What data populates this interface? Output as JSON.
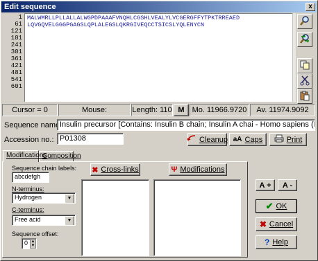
{
  "window": {
    "title": "Edit sequence",
    "close_glyph": "x"
  },
  "sequence": {
    "line_numbers": [
      "1",
      "61",
      "121",
      "181",
      "241",
      "301",
      "361",
      "421",
      "481",
      "541",
      "601"
    ],
    "lines": [
      "MALWMRLLPLLALLALWGPDPAAAFVNQHLCGSHLVEALYLVCGERGFFYTPKTRREAED",
      "LQVGQVELGGGPGAGSLQPLALEGSLQKRGIVEQCCTSICSLYQLENYCN"
    ]
  },
  "toolbar": {
    "icons": [
      "search-icon",
      "find-replace-icon",
      "copy-icon",
      "cut-icon",
      "paste-icon"
    ]
  },
  "status": {
    "cursor": "Cursor = 0",
    "mouse": "Mouse:",
    "length": "Length: 110",
    "m_button": "M",
    "mono": "Mo. 11966.9720",
    "avg": "Av. 11974.9092"
  },
  "fields": {
    "sequence_name_label": "Sequence name:",
    "sequence_name_value": "Insulin precursor [Contains: Insulin B chain; Insulin A chai - Homo sapiens (Human).",
    "accession_label": "Accession no.:",
    "accession_value": "P01308"
  },
  "buttons": {
    "cleanup": "Cleanup",
    "caps": "Caps",
    "caps_prefix": "aA",
    "print": "Print",
    "cross_links": "Cross-links",
    "modifications": "Modifications",
    "font_bigger": "A +",
    "font_smaller": "A -",
    "ok": "OK",
    "cancel": "Cancel",
    "help": "Help"
  },
  "tabs": [
    {
      "label": "Modifications",
      "active": true
    },
    {
      "label": "Composition",
      "active": false
    }
  ],
  "modifications": {
    "chain_labels_label": "Sequence chain labels:",
    "chain_labels_value": "abcdefgh",
    "n_terminus_label": "N-terminus:",
    "n_terminus_value": "Hydrogen",
    "c_terminus_label": "C-terminus:",
    "c_terminus_value": "Free acid",
    "offset_label": "Sequence offset:",
    "offset_value": "0"
  },
  "colors": {
    "title_start": "#0a246a",
    "title_end": "#a6caf0",
    "face": "#d4d0c8",
    "sequence_text": "#2020a0",
    "ok_check": "#008000",
    "cancel_x": "#c00000"
  }
}
